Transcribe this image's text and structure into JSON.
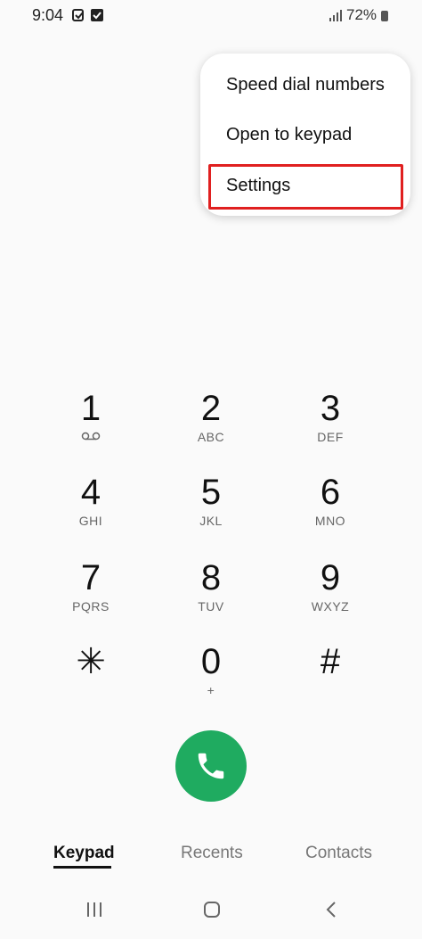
{
  "status_bar": {
    "time": "9:04",
    "battery": "72%",
    "icons": [
      "notification-icon",
      "checkbox-icon",
      "signal-icon",
      "battery-icon"
    ]
  },
  "menu": {
    "items": [
      "Speed dial numbers",
      "Open to keypad",
      "Settings"
    ],
    "highlighted_item": "Settings",
    "highlight_color": "#e02020"
  },
  "keypad": {
    "keys": [
      {
        "digit": "1",
        "letters": ""
      },
      {
        "digit": "2",
        "letters": "ABC"
      },
      {
        "digit": "3",
        "letters": "DEF"
      },
      {
        "digit": "4",
        "letters": "GHI"
      },
      {
        "digit": "5",
        "letters": "JKL"
      },
      {
        "digit": "6",
        "letters": "MNO"
      },
      {
        "digit": "7",
        "letters": "PQRS"
      },
      {
        "digit": "8",
        "letters": "TUV"
      },
      {
        "digit": "9",
        "letters": "WXYZ"
      },
      {
        "digit": "✳",
        "letters": ""
      },
      {
        "digit": "0",
        "letters": "+"
      },
      {
        "digit": "#",
        "letters": ""
      }
    ]
  },
  "call_button": {
    "color": "#1fab60",
    "icon": "phone-icon"
  },
  "tabs": [
    {
      "label": "Keypad",
      "active": true
    },
    {
      "label": "Recents",
      "active": false
    },
    {
      "label": "Contacts",
      "active": false
    }
  ],
  "nav_bar": {
    "icons": [
      "recent-apps-icon",
      "home-icon",
      "back-icon"
    ]
  }
}
